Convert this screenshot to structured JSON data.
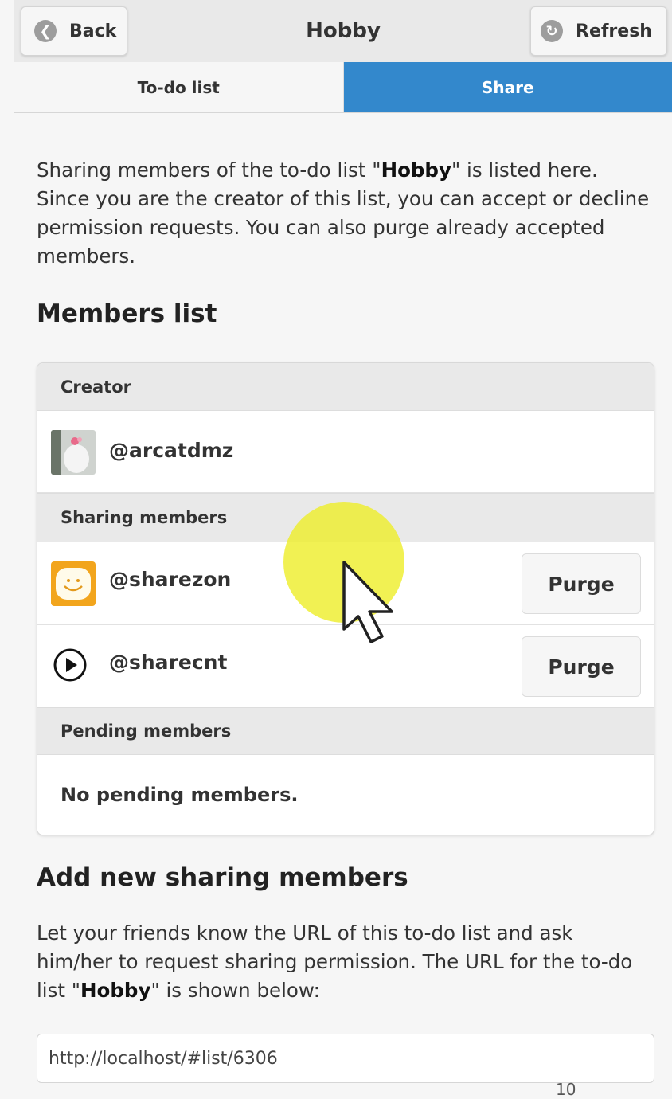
{
  "header": {
    "back_label": "Back",
    "title": "Hobby",
    "refresh_label": "Refresh"
  },
  "tabs": [
    {
      "label": "To-do list",
      "active": false
    },
    {
      "label": "Share",
      "active": true
    }
  ],
  "intro": {
    "part1": "Sharing members of the to-do list \"",
    "list_name": "Hobby",
    "part2": "\" is listed here. Since you are the creator of this list, you can accept or decline permission requests. You can also purge already accepted members."
  },
  "members_heading": "Members list",
  "creator": {
    "divider": "Creator",
    "username": "@arcatdmz"
  },
  "sharing": {
    "divider": "Sharing members",
    "members": [
      {
        "username": "@sharezon",
        "action": "Purge",
        "icon": "smiley-avatar"
      },
      {
        "username": "@sharecnt",
        "action": "Purge",
        "icon": "play-circle-icon"
      }
    ]
  },
  "pending": {
    "divider": "Pending members",
    "empty_text": "No pending members."
  },
  "add_section": {
    "heading": "Add new sharing members",
    "part1": "Let your friends know the URL of this to-do list and ask him/her to request sharing permission. The URL for the to-do list \"",
    "list_name": "Hobby",
    "part2": "\" is shown below:",
    "url": "http://localhost/#list/6306"
  },
  "page_number": "10",
  "colors": {
    "accent": "#3388cc",
    "highlight": "#eeee28",
    "smiley_bg": "#f2a51d"
  }
}
